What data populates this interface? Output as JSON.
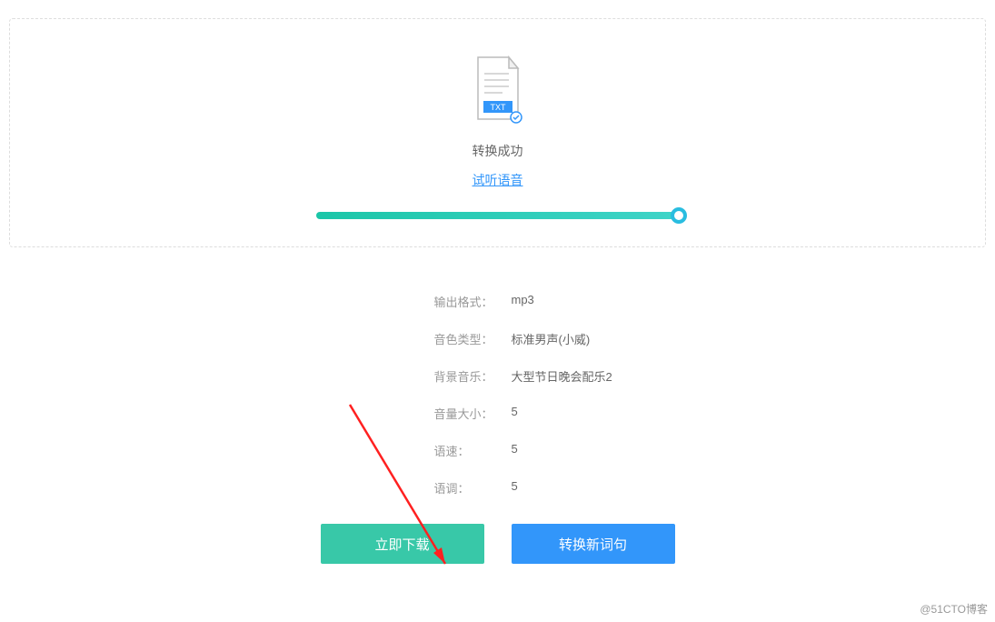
{
  "status": "转换成功",
  "preview_link": "试听语音",
  "file_icon_label": "TXT",
  "settings": {
    "output_format": {
      "label": "输出格式：",
      "value": "mp3"
    },
    "voice_type": {
      "label": "音色类型：",
      "value": "标准男声(小威)"
    },
    "bg_music": {
      "label": "背景音乐：",
      "value": "大型节日晚会配乐2"
    },
    "volume": {
      "label": "音量大小：",
      "value": "5"
    },
    "speed": {
      "label": "语速：",
      "value": "5"
    },
    "tone": {
      "label": "语调：",
      "value": "5"
    }
  },
  "buttons": {
    "download": "立即下载",
    "convert_new": "转换新词句"
  },
  "watermark": "@51CTO博客"
}
